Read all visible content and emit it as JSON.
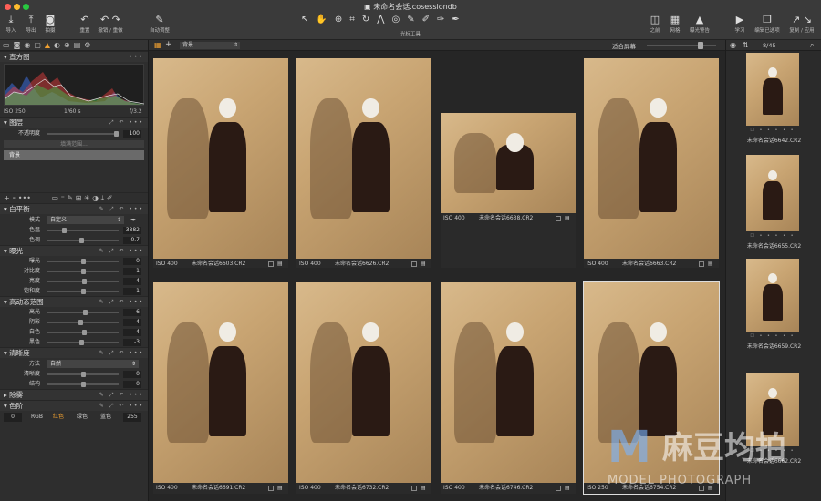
{
  "window_title": "未命名会话.cosessiondb",
  "colors": {
    "close": "#ff5f57",
    "minimize": "#febc2e",
    "maximize": "#28c840",
    "accent_tab": "#f0a030"
  },
  "toolbar": {
    "left": [
      {
        "icon": "import-icon",
        "label": "导入"
      },
      {
        "icon": "export-icon",
        "label": "导出"
      },
      {
        "icon": "camera-icon",
        "label": "拍摄"
      },
      {
        "icon": "reset-icon",
        "label": "重置"
      },
      {
        "icon": "undo-redo-icon",
        "label": "撤销 / 重做"
      },
      {
        "icon": "auto-adjust-icon",
        "label": "自动调整"
      }
    ],
    "cursor_tools_label": "光标工具",
    "right": [
      {
        "icon": "before-icon",
        "label": "之前"
      },
      {
        "icon": "grid-icon",
        "label": "网格"
      },
      {
        "icon": "exposure-warning-icon",
        "label": "曝光警告"
      },
      {
        "icon": "learn-icon",
        "label": "学习"
      },
      {
        "icon": "edit-selected-icon",
        "label": "编辑已选项"
      },
      {
        "icon": "copy-apply-icon",
        "label": "复制 / 应用"
      }
    ]
  },
  "left_panel": {
    "histogram": {
      "title": "直方图",
      "iso": "ISO 250",
      "shutter": "1/60 s",
      "aperture": "f/3.2"
    },
    "layers": {
      "title": "图层",
      "opacity_label": "不透明度",
      "opacity_value": "100",
      "fill_button": "填满范围...",
      "selected_layer": "背景"
    },
    "white_balance": {
      "title": "白平衡",
      "mode_label": "模式",
      "mode_value": "自定义",
      "rows": [
        {
          "label": "色温",
          "value": "3882",
          "pos": 0.22
        },
        {
          "label": "色调",
          "value": "-0.7",
          "pos": 0.48
        }
      ]
    },
    "exposure": {
      "title": "曝光",
      "rows": [
        {
          "label": "曝光",
          "value": "0",
          "pos": 0.5
        },
        {
          "label": "对比度",
          "value": "1",
          "pos": 0.5
        },
        {
          "label": "亮度",
          "value": "4",
          "pos": 0.52
        },
        {
          "label": "饱和度",
          "value": "-1",
          "pos": 0.5
        }
      ]
    },
    "hdr": {
      "title": "高动态范围",
      "rows": [
        {
          "label": "高光",
          "value": "6",
          "pos": 0.54
        },
        {
          "label": "阴影",
          "value": "-4",
          "pos": 0.47
        },
        {
          "label": "白色",
          "value": "4",
          "pos": 0.52
        },
        {
          "label": "黑色",
          "value": "-3",
          "pos": 0.48
        }
      ]
    },
    "clarity": {
      "title": "清晰度",
      "method_label": "方法",
      "method_value": "自然",
      "rows": [
        {
          "label": "清晰度",
          "value": "0",
          "pos": 0.5
        },
        {
          "label": "结构",
          "value": "0",
          "pos": 0.5
        }
      ]
    },
    "dehaze": {
      "title": "除雾"
    },
    "levels": {
      "title": "色阶",
      "left_value": "0",
      "tabs": [
        "RGB",
        "红色",
        "绿色",
        "蓝色"
      ],
      "right_value": "255"
    }
  },
  "main": {
    "layer_select": "背景",
    "fit_label": "适合屏幕",
    "thumbs": [
      {
        "iso": "ISO 400",
        "name": "未命名会话6603.CR2"
      },
      {
        "iso": "ISO 400",
        "name": "未命名会话6626.CR2"
      },
      {
        "iso": "ISO 400",
        "name": "未命名会话6638.CR2"
      },
      {
        "iso": "ISO 400",
        "name": "未命名会话6663.CR2"
      },
      {
        "iso": "ISO 400",
        "name": "未命名会话6691.CR2"
      },
      {
        "iso": "ISO 400",
        "name": "未命名会话6732.CR2"
      },
      {
        "iso": "ISO 400",
        "name": "未命名会话6746.CR2"
      },
      {
        "iso": "ISO 250",
        "name": "未命名会话6754.CR2"
      }
    ]
  },
  "right_panel": {
    "count": "8/45",
    "thumbs": [
      {
        "name": "未命名会话6642.CR2"
      },
      {
        "name": "未命名会话6655.CR2"
      },
      {
        "name": "未命名会话6659.CR2"
      },
      {
        "name": "未命名会话6662.CR2"
      }
    ]
  },
  "watermark": {
    "mark": "M",
    "brand": "麻豆均拍",
    "sub": "MODEL PHOTOGRAPH"
  }
}
